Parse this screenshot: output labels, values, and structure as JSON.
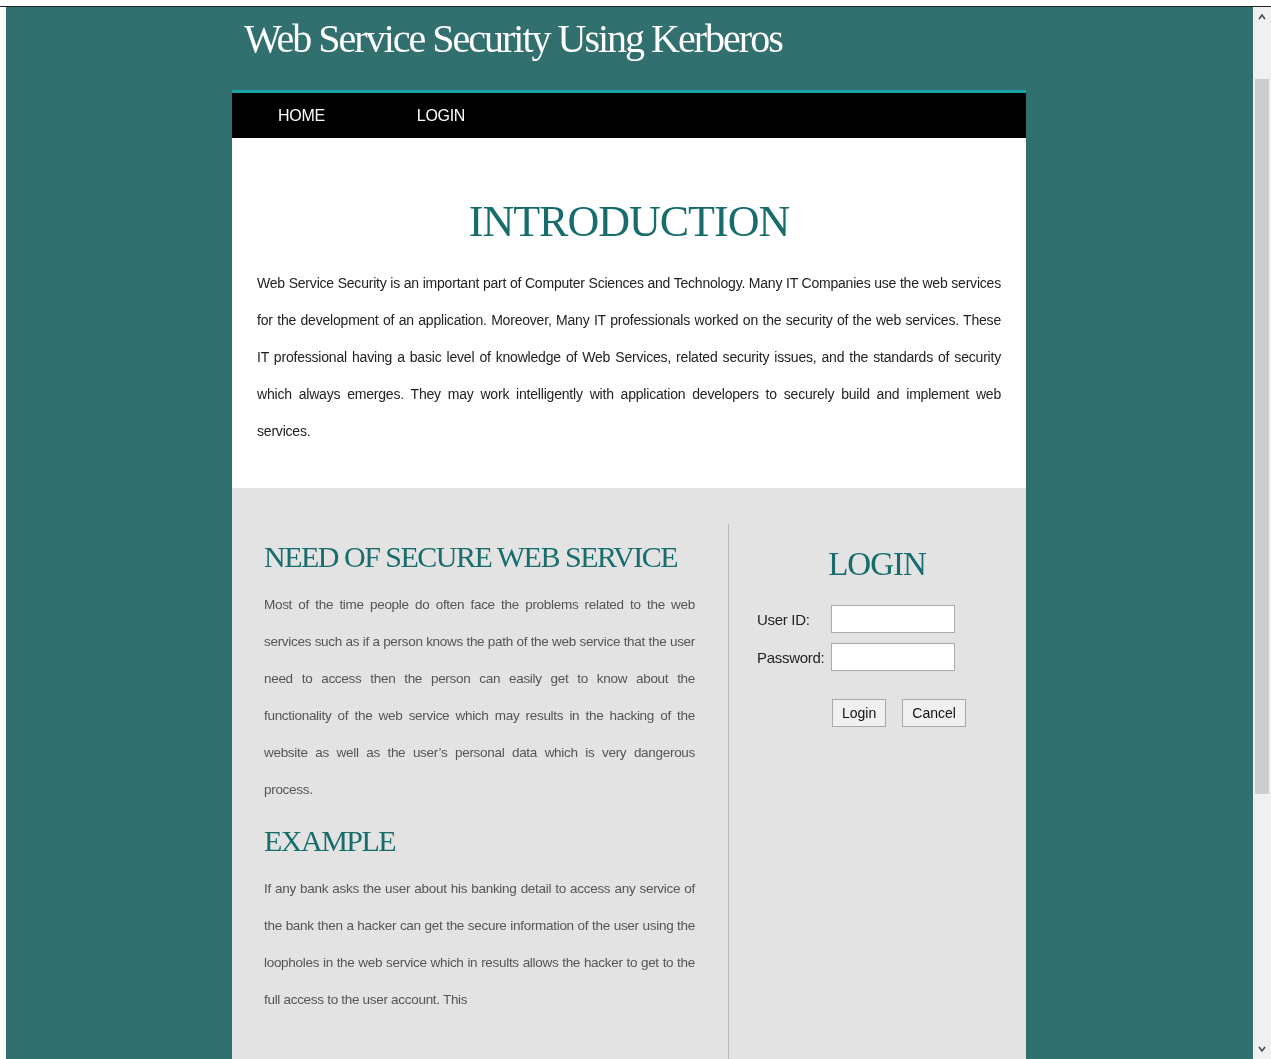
{
  "site_title": "Web Service Security Using Kerberos",
  "nav": [
    {
      "label": "HOME"
    },
    {
      "label": "LOGIN"
    }
  ],
  "intro": {
    "heading": "INTRODUCTION",
    "text": "Web Service Security is an important part of Computer Sciences and Technology. Many IT Companies use the web services for the development of an application. Moreover, Many IT professionals worked on the security of the web services. These IT professional having a basic level of knowledge of Web Services, related security issues, and the standards of security which always emerges. They may work intelligently with application developers to securely build and implement web services."
  },
  "sections": [
    {
      "heading": "NEED OF SECURE WEB SERVICE",
      "text": "Most of the time people do often face the problems related to the web services such as if a person knows the path of the web service that the user need to access then the person can easily get to know about the functionality of the web service which may results in the hacking of the website as well as the user’s personal data which is very dangerous process."
    },
    {
      "heading": "EXAMPLE",
      "text": "If any bank asks the user about his banking detail to access any service of the bank then a hacker can get the secure information of the user using the loopholes in the web service which in results allows the hacker to get to the full access to the user account. This"
    }
  ],
  "login": {
    "heading": "LOGIN",
    "fields": [
      {
        "label": "User ID:"
      },
      {
        "label": "Password:"
      }
    ],
    "buttons": [
      "Login",
      "Cancel"
    ]
  }
}
